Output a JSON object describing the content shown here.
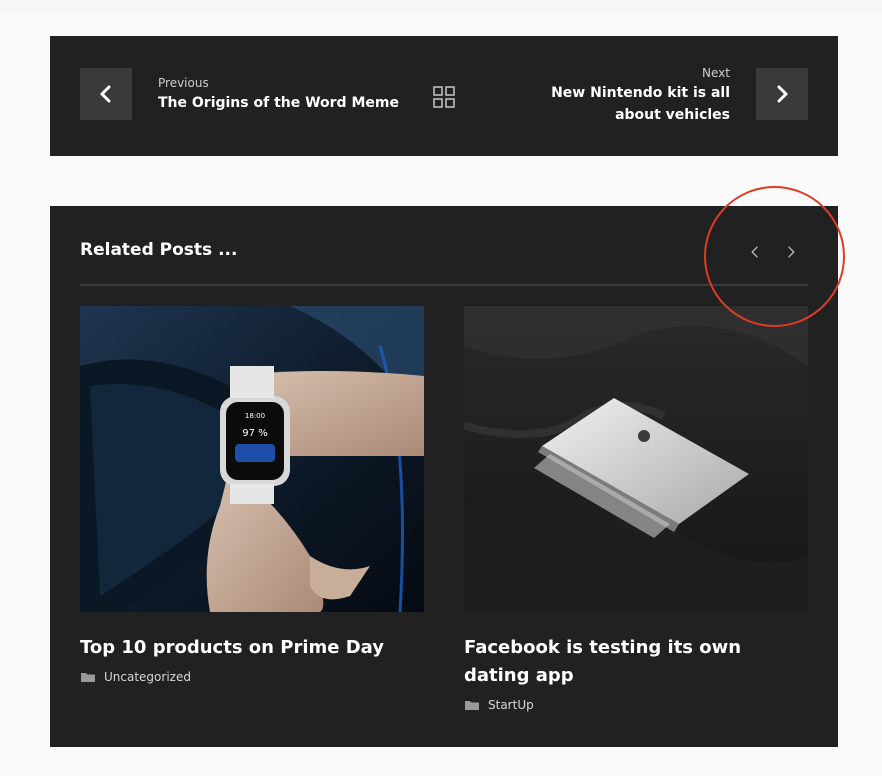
{
  "post_nav": {
    "previous_label": "Previous",
    "previous_title": "The Origins of the Word Meme",
    "next_label": "Next",
    "next_title": "New Nintendo kit is all about vehicles"
  },
  "related": {
    "title": "Related Posts ...",
    "posts": [
      {
        "title": "Top 10 products on Prime Day",
        "category": "Uncategorized"
      },
      {
        "title": "Facebook is testing its own dating app",
        "category": "StartUp"
      }
    ],
    "watch_screen": {
      "time": "18:00",
      "battery": "97 %"
    }
  },
  "colors": {
    "panel_bg": "#212121",
    "button_bg": "#3a3a3a",
    "annotation": "#e03a22"
  }
}
